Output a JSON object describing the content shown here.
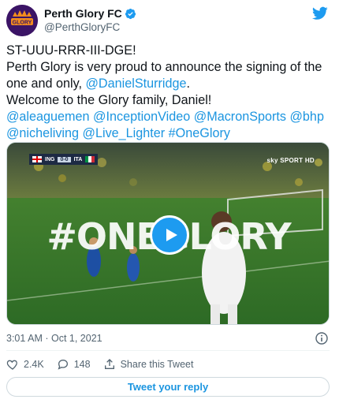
{
  "author": {
    "display_name": "Perth Glory FC",
    "handle": "@PerthGloryFC",
    "avatar_text": "GLORY",
    "verified": true,
    "avatar_color": "#3b1466"
  },
  "tweet": {
    "lines": [
      {
        "parts": [
          {
            "text": "ST-UUU-RRR-III-DGE!",
            "mention": false
          }
        ]
      },
      {
        "parts": [
          {
            "text": "Perth Glory is very proud to announce the signing of the",
            "mention": false
          }
        ]
      },
      {
        "parts": [
          {
            "text": "one and only, ",
            "mention": false
          },
          {
            "text": "@DanielSturridge",
            "mention": true
          },
          {
            "text": ".",
            "mention": false
          }
        ]
      },
      {
        "parts": [
          {
            "text": "Welcome to the Glory family, Daniel!",
            "mention": false
          }
        ]
      },
      {
        "parts": [
          {
            "text": "@aleaguemen",
            "mention": true
          },
          {
            "text": " ",
            "mention": false
          },
          {
            "text": "@InceptionVideo",
            "mention": true
          },
          {
            "text": " ",
            "mention": false
          },
          {
            "text": "@MacronSports",
            "mention": true
          },
          {
            "text": " ",
            "mention": false
          },
          {
            "text": "@bhp",
            "mention": true
          }
        ]
      },
      {
        "parts": [
          {
            "text": "@nicheliving",
            "mention": true
          },
          {
            "text": " ",
            "mention": false
          },
          {
            "text": "@Live_Lighter",
            "mention": true
          },
          {
            "text": " ",
            "mention": false
          },
          {
            "text": "#OneGlory",
            "mention": true
          }
        ]
      }
    ]
  },
  "media": {
    "overlay_text": "#ONEGLORY",
    "scorebug": {
      "team_a": "ING",
      "score": "0-0",
      "team_b": "ITA"
    },
    "broadcaster": "sky SPORT HD"
  },
  "meta": {
    "timestamp": "3:01 AM · Oct 1, 2021"
  },
  "actions": {
    "likes": "2.4K",
    "replies": "148",
    "share_label": "Share this Tweet"
  },
  "reply_button": {
    "label": "Tweet your reply"
  },
  "colors": {
    "link": "#1b95e0",
    "accent": "#1d9bf0",
    "text": "#0f1419",
    "secondary": "#536471"
  }
}
